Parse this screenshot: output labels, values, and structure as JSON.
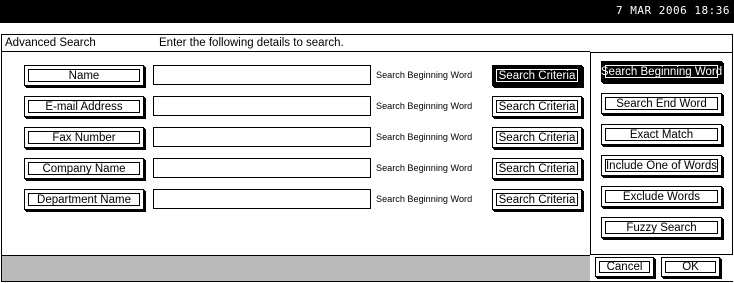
{
  "status_bar": {
    "datetime": "7  MAR  2006 18:36"
  },
  "dialog": {
    "title": "Advanced Search",
    "instruction": "Enter the following details to search."
  },
  "fields": [
    {
      "label": "Name",
      "value": "",
      "mode": "Search Beginning Word",
      "criteria_label": "Search Criteria",
      "criteria_active": true
    },
    {
      "label": "E-mail Address",
      "value": "",
      "mode": "Search Beginning Word",
      "criteria_label": "Search Criteria",
      "criteria_active": false
    },
    {
      "label": "Fax Number",
      "value": "",
      "mode": "Search Beginning Word",
      "criteria_label": "Search Criteria",
      "criteria_active": false
    },
    {
      "label": "Company Name",
      "value": "",
      "mode": "Search Beginning Word",
      "criteria_label": "Search Criteria",
      "criteria_active": false
    },
    {
      "label": "Department Name",
      "value": "",
      "mode": "Search Beginning Word",
      "criteria_label": "Search Criteria",
      "criteria_active": false
    }
  ],
  "criteria_options": [
    {
      "label": "Search Beginning Word",
      "selected": true
    },
    {
      "label": "Search End Word",
      "selected": false
    },
    {
      "label": "Exact Match",
      "selected": false
    },
    {
      "label": "Include One of Words",
      "selected": false
    },
    {
      "label": "Exclude Words",
      "selected": false
    },
    {
      "label": "Fuzzy Search",
      "selected": false
    }
  ],
  "actions": {
    "cancel": "Cancel",
    "ok": "OK"
  }
}
